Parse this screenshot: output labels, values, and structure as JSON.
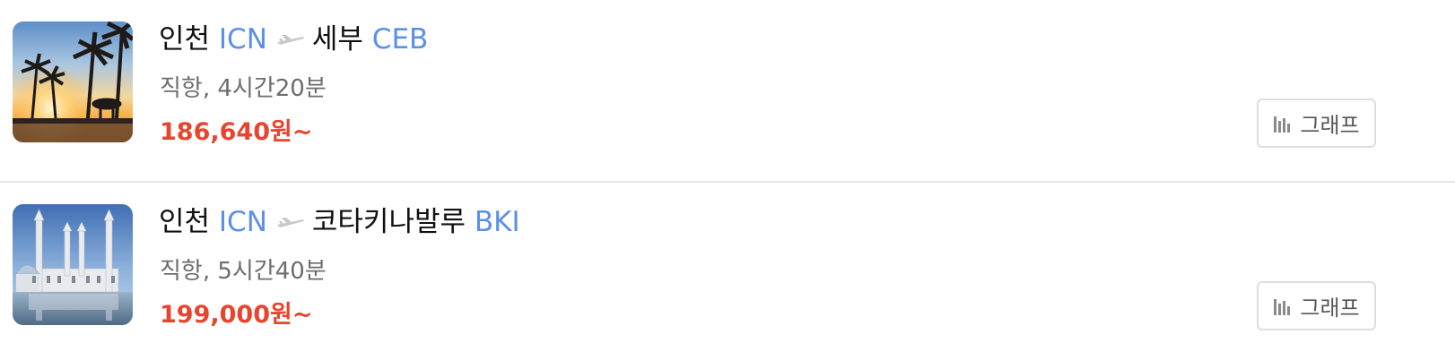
{
  "routes": [
    {
      "origin_city": "인천",
      "origin_code": "ICN",
      "dest_city": "세부",
      "dest_code": "CEB",
      "flight_info": "직항, 4시간20분",
      "price": "186,640원~",
      "graph_label": "그래프",
      "thumbnail": "tropical-sunset-palms"
    },
    {
      "origin_city": "인천",
      "origin_code": "ICN",
      "dest_city": "코타키나발루",
      "dest_code": "BKI",
      "flight_info": "직항, 5시간40분",
      "price": "199,000원~",
      "graph_label": "그래프",
      "thumbnail": "mosque-waterfront"
    }
  ],
  "icons": {
    "route_separator": "airplane-icon",
    "graph": "bar-chart-icon"
  },
  "colors": {
    "airport_code": "#5b8fe8",
    "price": "#e8452f",
    "secondary_text": "#6d6d6d",
    "divider": "#e6e6e6"
  }
}
